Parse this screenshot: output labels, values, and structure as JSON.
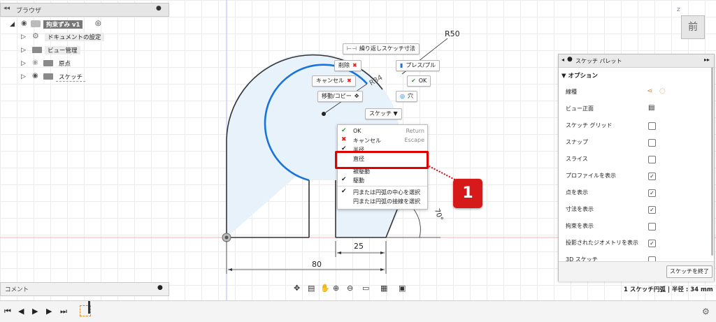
{
  "browser": {
    "title": "ブラウザ",
    "items": [
      {
        "label": "拘束ずみ v1",
        "icon": "component-icon"
      },
      {
        "label": "ドキュメントの設定",
        "icon": "gear-icon"
      },
      {
        "label": "ビュー管理",
        "icon": "folder-icon"
      },
      {
        "label": "原点",
        "icon": "folder-icon"
      },
      {
        "label": "スケッチ",
        "icon": "folder-icon"
      }
    ]
  },
  "comment": {
    "title": "コメント"
  },
  "viewcube": {
    "label": "前",
    "axis": "Z"
  },
  "sketch": {
    "dims": {
      "r50": "R50",
      "r34": "R34",
      "d25": "25",
      "d80": "80",
      "angle": "70°"
    },
    "marker": "1",
    "colors": {
      "profile": "#e8f2fb",
      "arc": "#1a73d9",
      "highlight": "#e00000"
    }
  },
  "toolbuttons": {
    "repeat_dim": "繰り返しスケッチ寸法",
    "delete": "削除",
    "pressPull": "プレス/プル",
    "cancel": "キャンセル",
    "ok": "OK",
    "moveCopy": "移動/コピー",
    "hole": "穴",
    "sketch": "スケッチ ▼"
  },
  "contextmenu": {
    "items": [
      {
        "label": "OK",
        "shortcut": "Return",
        "mark": "✔"
      },
      {
        "label": "キャンセル",
        "shortcut": "Escape",
        "mark": "✖"
      },
      {
        "label": "半径",
        "shortcut": "",
        "mark": "✔"
      },
      {
        "label": "直径",
        "shortcut": "",
        "mark": ""
      },
      {
        "label": "被駆動",
        "shortcut": "",
        "mark": ""
      },
      {
        "label": "駆動",
        "shortcut": "",
        "mark": "✔"
      },
      {
        "label": "円または円弧の中心を選択",
        "shortcut": "",
        "mark": "✔"
      },
      {
        "label": "円または円弧の接線を選択",
        "shortcut": "",
        "mark": ""
      }
    ]
  },
  "palette": {
    "title": "スケッチ パレット",
    "section": "▼ オプション",
    "rows": [
      {
        "label": "線種",
        "type": "icons"
      },
      {
        "label": "ビュー正面",
        "type": "icon"
      },
      {
        "label": "スケッチ グリッド",
        "type": "check",
        "checked": false
      },
      {
        "label": "スナップ",
        "type": "check",
        "checked": false
      },
      {
        "label": "スライス",
        "type": "check",
        "checked": false
      },
      {
        "label": "プロファイルを表示",
        "type": "check",
        "checked": true
      },
      {
        "label": "点を表示",
        "type": "check",
        "checked": true
      },
      {
        "label": "寸法を表示",
        "type": "check",
        "checked": true
      },
      {
        "label": "拘束を表示",
        "type": "check",
        "checked": false
      },
      {
        "label": "投影されたジオメトリを表示",
        "type": "check",
        "checked": true
      },
      {
        "label": "3D スケッチ",
        "type": "check",
        "checked": false
      }
    ],
    "finish": "スケッチを終了"
  },
  "status": {
    "text": "1 スケッチ円弧 | 半径 : 34 mm"
  }
}
